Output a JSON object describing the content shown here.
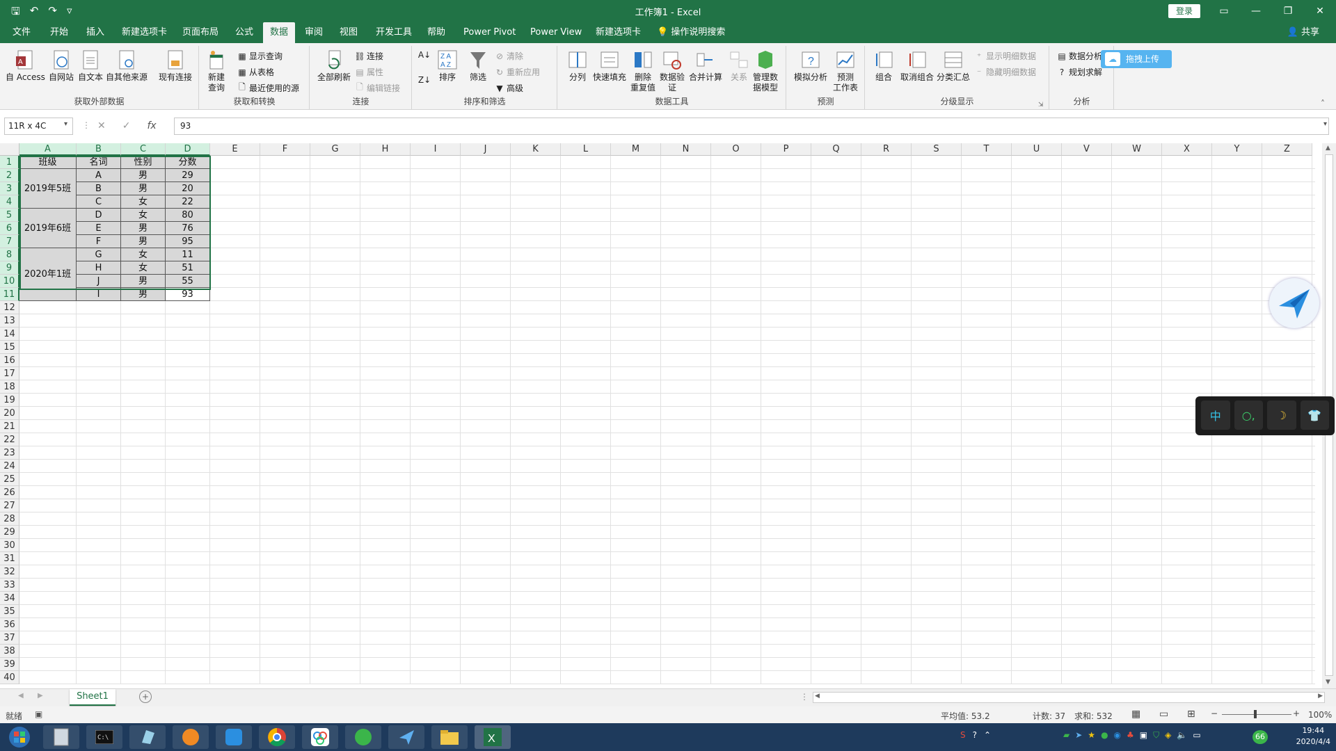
{
  "window": {
    "title": "工作簿1  -  Excel",
    "login_label": "登录",
    "share_label": "共享"
  },
  "menu": {
    "tabs": [
      "文件",
      "开始",
      "插入",
      "新建选项卡",
      "页面布局",
      "公式",
      "数据",
      "审阅",
      "视图",
      "开发工具",
      "帮助",
      "Power Pivot",
      "Power View",
      "新建选项卡"
    ],
    "active": "数据",
    "tell_me": "操作说明搜索"
  },
  "ribbon": {
    "get_external": {
      "label": "获取外部数据",
      "buttons": [
        "自 Access",
        "自网站",
        "自文本",
        "自其他来源",
        "现有连接"
      ]
    },
    "get_transform": {
      "label": "获取和转换",
      "new_query": "新建\n查询",
      "show_queries": "显示查询",
      "from_table": "从表格",
      "recent_sources": "最近使用的源"
    },
    "connections": {
      "label": "连接",
      "refresh_all": "全部刷新",
      "connections": "连接",
      "properties": "属性",
      "edit_links": "编辑链接"
    },
    "sort_filter": {
      "label": "排序和筛选",
      "sort": "排序",
      "filter": "筛选",
      "clear": "清除",
      "reapply": "重新应用",
      "advanced": "高级"
    },
    "data_tools": {
      "label": "数据工具",
      "buttons": [
        "分列",
        "快速填充",
        "删除\n重复值",
        "数据验\n证",
        "合并计算",
        "关系",
        "管理数\n据模型"
      ]
    },
    "forecast": {
      "label": "预测",
      "buttons": [
        "模拟分析",
        "预测\n工作表"
      ]
    },
    "outline": {
      "label": "分级显示",
      "buttons": [
        "组合",
        "取消组合",
        "分类汇总"
      ],
      "show_detail": "显示明细数据",
      "hide_detail": "隐藏明细数据"
    },
    "analysis": {
      "label": "分析",
      "data_analysis": "数据分析",
      "solver": "规划求解"
    }
  },
  "upload_widget": "拖拽上传",
  "formula_bar": {
    "name_box": "11R x 4C",
    "value": "93"
  },
  "columns": [
    "A",
    "B",
    "C",
    "D",
    "E",
    "F",
    "G",
    "H",
    "I",
    "J",
    "K",
    "L",
    "M",
    "N",
    "O",
    "P",
    "Q",
    "R",
    "S",
    "T",
    "U",
    "V",
    "W",
    "X",
    "Y",
    "Z"
  ],
  "rows": [
    "1",
    "2",
    "3",
    "4",
    "5",
    "6",
    "7",
    "8",
    "9",
    "10",
    "11",
    "12",
    "13",
    "14",
    "15",
    "16",
    "17",
    "18",
    "19",
    "20",
    "21",
    "22",
    "23",
    "24",
    "25",
    "26",
    "27",
    "28",
    "29",
    "30",
    "31",
    "32",
    "33",
    "34",
    "35",
    "36",
    "37",
    "38",
    "39",
    "40"
  ],
  "table": {
    "headers": [
      "班级",
      "名词",
      "性别",
      "分数"
    ],
    "groups": [
      {
        "label": "2019年5班",
        "rows": 3
      },
      {
        "label": "2019年6班",
        "rows": 3
      },
      {
        "label": "2020年1班",
        "rows": 4
      }
    ],
    "records": [
      [
        "A",
        "男",
        "29"
      ],
      [
        "B",
        "男",
        "20"
      ],
      [
        "C",
        "女",
        "22"
      ],
      [
        "D",
        "女",
        "80"
      ],
      [
        "E",
        "男",
        "76"
      ],
      [
        "F",
        "男",
        "95"
      ],
      [
        "G",
        "女",
        "11"
      ],
      [
        "H",
        "女",
        "51"
      ],
      [
        "J",
        "男",
        "55"
      ],
      [
        "I",
        "男",
        "93"
      ]
    ]
  },
  "sheet_tabs": [
    "Sheet1"
  ],
  "status": {
    "ready": "就绪",
    "average": "平均值: 53.2",
    "count": "计数: 37",
    "sum": "求和: 532",
    "zoom": "100%"
  },
  "ime_widget": [
    "中",
    "○,",
    "☽",
    "👕"
  ],
  "taskbar": {
    "time": "19:44",
    "date": "2020/4/4",
    "badge": "66"
  },
  "colors": {
    "excel_green": "#217346",
    "grey_fill": "#d8d8d8",
    "taskbar": "#1e3a5c"
  }
}
